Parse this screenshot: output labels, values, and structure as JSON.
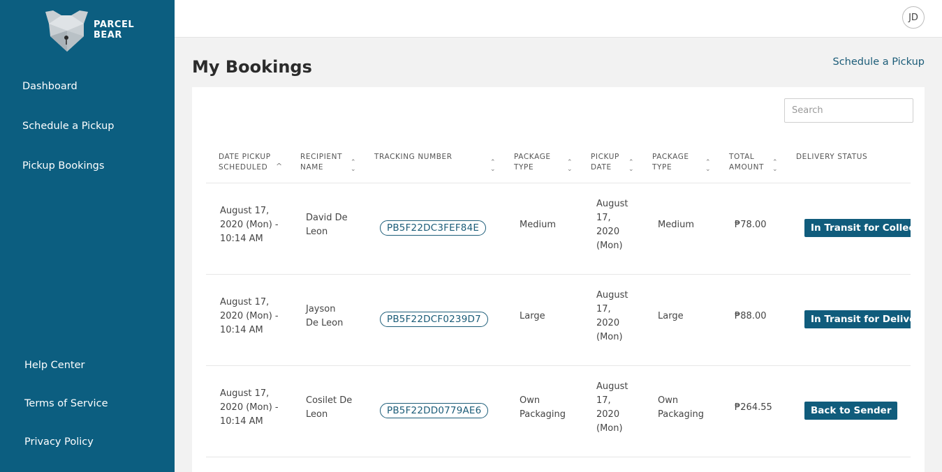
{
  "brand": {
    "line1": "PARCEL",
    "line2": "BEAR"
  },
  "sidebar": {
    "nav": [
      "Dashboard",
      "Schedule a Pickup",
      "Pickup Bookings"
    ],
    "footer": [
      "Help Center",
      "Terms of Service",
      "Privacy Policy"
    ]
  },
  "user": {
    "initials": "JD"
  },
  "page": {
    "title": "My Bookings",
    "action_link": "Schedule a Pickup"
  },
  "search": {
    "placeholder": "Search",
    "value": ""
  },
  "table": {
    "columns": [
      "Date Pickup Scheduled",
      "Recipient Name",
      "Tracking Number",
      "Package Type",
      "Pickup Date",
      "Package Type",
      "Total Amount",
      "Delivery Status"
    ],
    "rows": [
      {
        "date_scheduled": [
          "August 17,",
          "2020 (Mon) -",
          "10:14 AM"
        ],
        "recipient": [
          "David De",
          "Leon"
        ],
        "tracking": "PB5F22DC3FEF84E",
        "package_type": [
          "Medium"
        ],
        "pickup_date": [
          "August",
          "17,",
          "2020",
          "(Mon)"
        ],
        "package_type2": [
          "Medium"
        ],
        "amount": "₱78.00",
        "status": "In Transit for Collection"
      },
      {
        "date_scheduled": [
          "August 17,",
          "2020 (Mon) -",
          "10:14 AM"
        ],
        "recipient": [
          "Jayson",
          "De Leon"
        ],
        "tracking": "PB5F22DCF0239D7",
        "package_type": [
          "Large"
        ],
        "pickup_date": [
          "August",
          "17,",
          "2020",
          "(Mon)"
        ],
        "package_type2": [
          "Large"
        ],
        "amount": "₱88.00",
        "status": "In Transit for Delivery"
      },
      {
        "date_scheduled": [
          "August 17,",
          "2020 (Mon) -",
          "10:14 AM"
        ],
        "recipient": [
          "Cosilet De",
          "Leon"
        ],
        "tracking": "PB5F22DD0779AE6",
        "package_type": [
          "Own",
          "Packaging"
        ],
        "pickup_date": [
          "August",
          "17,",
          "2020",
          "(Mon)"
        ],
        "package_type2": [
          "Own",
          "Packaging"
        ],
        "amount": "₱264.55",
        "status": "Back to Sender"
      }
    ]
  },
  "colors": {
    "sidebar": "#0c5e80",
    "accent": "#105c7c",
    "link": "#1b5c78"
  }
}
